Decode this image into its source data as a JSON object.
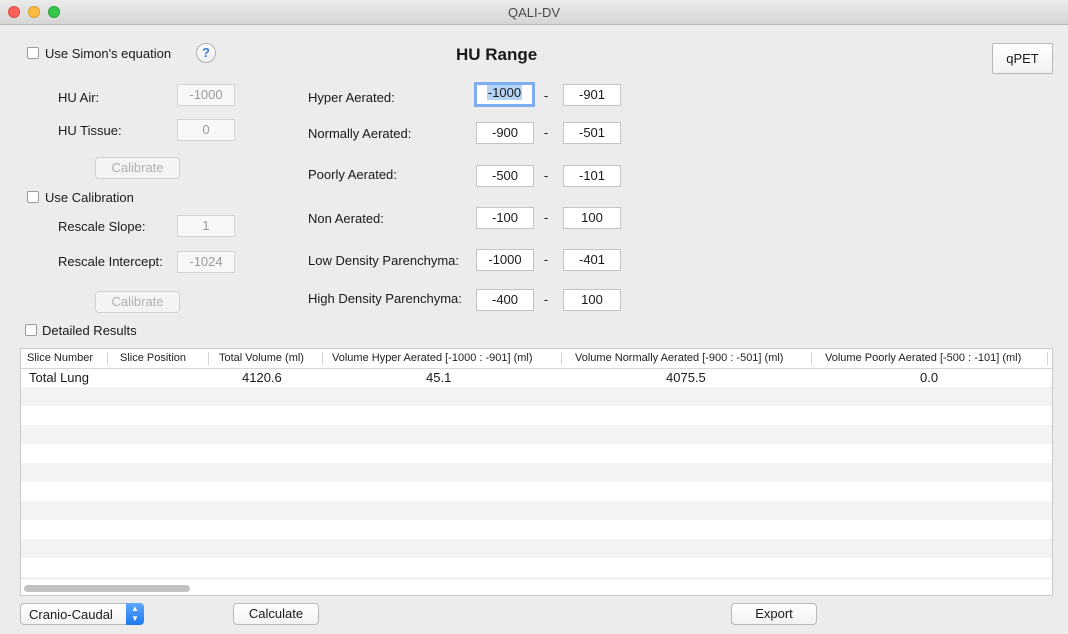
{
  "window": {
    "title": "QALI-DV"
  },
  "left": {
    "simon_label": "Use Simon's equation",
    "help": "?",
    "hu_air_label": "HU Air:",
    "hu_air_value": "-1000",
    "hu_tissue_label": "HU Tissue:",
    "hu_tissue_value": "0",
    "calibrate_label": "Calibrate",
    "use_calibration_label": "Use Calibration",
    "rescale_slope_label": "Rescale Slope:",
    "rescale_slope_value": "1",
    "rescale_intercept_label": "Rescale Intercept:",
    "rescale_intercept_value": "-1024",
    "calibrate2_label": "Calibrate",
    "detailed_label": "Detailed Results"
  },
  "hu_range": {
    "title": "HU Range",
    "separator": "-",
    "rows": [
      {
        "label": "Hyper Aerated:",
        "min": "-1000",
        "max": "-901"
      },
      {
        "label": "Normally Aerated:",
        "min": "-900",
        "max": "-501"
      },
      {
        "label": "Poorly Aerated:",
        "min": "-500",
        "max": "-101"
      },
      {
        "label": "Non Aerated:",
        "min": "-100",
        "max": "100"
      },
      {
        "label": "Low Density Parenchyma:",
        "min": "-1000",
        "max": "-401"
      },
      {
        "label": "High Density Parenchyma:",
        "min": "-400",
        "max": "100"
      }
    ]
  },
  "qpet_label": "qPET",
  "table": {
    "headers": [
      "Slice Number",
      "Slice Position",
      "Total Volume (ml)",
      "Volume Hyper Aerated [-1000 : -901] (ml)",
      "Volume Normally Aerated [-900 : -501] (ml)",
      "Volume Poorly Aerated [-500 : -101] (ml)"
    ],
    "rows": [
      [
        "Total Lung",
        "",
        "4120.6",
        "45.1",
        "4075.5",
        "0.0"
      ]
    ]
  },
  "bottom": {
    "direction_value": "Cranio-Caudal",
    "calculate_label": "Calculate",
    "export_label": "Export"
  }
}
